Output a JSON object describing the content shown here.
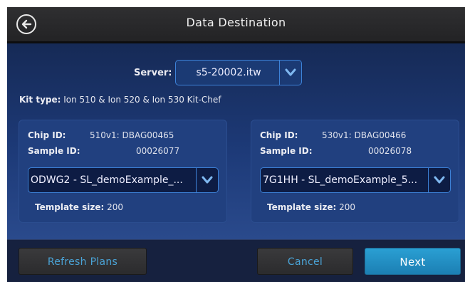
{
  "header": {
    "title": "Data Destination",
    "back_icon": "back-arrow-icon"
  },
  "server": {
    "label": "Server:",
    "value": "s5-20002.itw"
  },
  "kit": {
    "label": "Kit type:",
    "value": "Ion 510 & Ion 520 & Ion 530 Kit-Chef"
  },
  "chips": [
    {
      "chip_id_label": "Chip ID:",
      "chip_id": "510v1: DBAG00465",
      "sample_id_label": "Sample ID:",
      "sample_id": "00026077",
      "plan": "ODWG2 - SL_demoExample_...",
      "template_label": "Template size:",
      "template_size": "200"
    },
    {
      "chip_id_label": "Chip ID:",
      "chip_id": "530v1: DBAG00466",
      "sample_id_label": "Sample ID:",
      "sample_id": "00026078",
      "plan": "7G1HH - SL_demoExample_5...",
      "template_label": "Template size:",
      "template_size": "200"
    }
  ],
  "footer": {
    "refresh_label": "Refresh Plans",
    "cancel_label": "Cancel",
    "next_label": "Next"
  },
  "colors": {
    "accent": "#3d82d8",
    "next_button": "#2a9fd3",
    "link_text": "#4aa3d6",
    "background": "#1d3a78"
  }
}
